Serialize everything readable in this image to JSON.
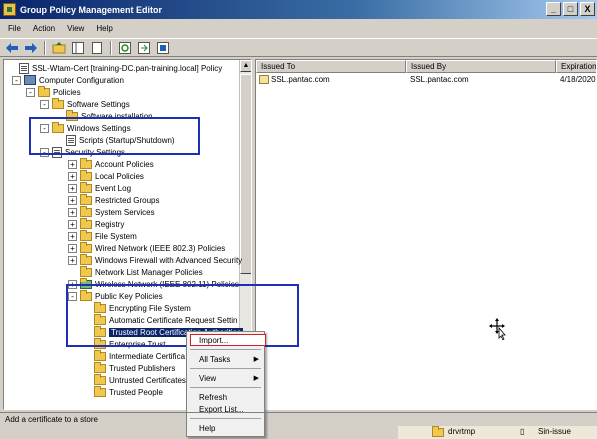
{
  "window": {
    "title": "Group Policy Management Editor",
    "buttons": [
      "_",
      "□",
      "X"
    ]
  },
  "menubar": [
    "File",
    "Action",
    "View",
    "Help"
  ],
  "toolbar": [
    "back-icon",
    "forward-icon",
    "up-icon",
    "show-hide-tree-icon",
    "properties-icon",
    "refresh-icon",
    "export-icon",
    "help-icon"
  ],
  "tree": [
    {
      "label": "SSL-Wtam-Cert [training-DC.pan-training.local] Policy",
      "icon": "document-icon",
      "exp": ""
    },
    {
      "label": "Computer Configuration",
      "icon": "computer-icon",
      "exp": "-"
    },
    {
      "label": "Policies",
      "icon": "folder-icon",
      "exp": "-"
    },
    {
      "label": "Software Settings",
      "icon": "folder-icon",
      "exp": "-"
    },
    {
      "label": "Software installation",
      "icon": "folder-icon",
      "exp": ""
    },
    {
      "label": "Windows Settings",
      "icon": "folder-icon",
      "exp": "-"
    },
    {
      "label": "Scripts (Startup/Shutdown)",
      "icon": "document-icon",
      "exp": ""
    },
    {
      "label": "Security Settings",
      "icon": "security-icon",
      "exp": "-"
    },
    {
      "label": "Account Policies",
      "icon": "folder-icon",
      "exp": "+"
    },
    {
      "label": "Local Policies",
      "icon": "folder-icon",
      "exp": "+"
    },
    {
      "label": "Event Log",
      "icon": "folder-icon",
      "exp": "+"
    },
    {
      "label": "Restricted Groups",
      "icon": "folder-icon",
      "exp": "+"
    },
    {
      "label": "System Services",
      "icon": "folder-icon",
      "exp": "+"
    },
    {
      "label": "Registry",
      "icon": "folder-icon",
      "exp": "+"
    },
    {
      "label": "File System",
      "icon": "folder-icon",
      "exp": "+"
    },
    {
      "label": "Wired Network (IEEE 802.3) Policies",
      "icon": "folder-icon",
      "exp": "+"
    },
    {
      "label": "Windows Firewall with Advanced Security",
      "icon": "folder-icon",
      "exp": "+"
    },
    {
      "label": "Network List Manager Policies",
      "icon": "folder-icon",
      "exp": ""
    },
    {
      "label": "Wireless Network (IEEE 802.11) Policies",
      "icon": "wireless-icon",
      "exp": "+"
    },
    {
      "label": "Public Key Policies",
      "icon": "folder-icon",
      "exp": "-"
    },
    {
      "label": "Encrypting File System",
      "icon": "folder-icon",
      "exp": ""
    },
    {
      "label": "Automatic Certificate Request Settin",
      "icon": "folder-icon",
      "exp": ""
    },
    {
      "label": "Trusted Root Certification Authorities",
      "icon": "folder-icon",
      "exp": ""
    },
    {
      "label": "Enterprise Trust",
      "icon": "folder-icon",
      "exp": ""
    },
    {
      "label": "Intermediate Certifica",
      "icon": "folder-icon",
      "exp": ""
    },
    {
      "label": "Trusted Publishers",
      "icon": "folder-icon",
      "exp": ""
    },
    {
      "label": "Untrusted Certificates",
      "icon": "folder-icon",
      "exp": ""
    },
    {
      "label": "Trusted People",
      "icon": "folder-icon",
      "exp": ""
    }
  ],
  "table": {
    "headers": [
      "Issued To",
      "Issued By",
      "Expiration"
    ],
    "rows": [
      [
        "SSL.pantac.com",
        "SSL.pantac.com",
        "4/18/2020"
      ]
    ]
  },
  "context_menu": {
    "items": [
      "Import...",
      "All Tasks",
      "View",
      "Refresh",
      "Export List...",
      "Help"
    ]
  },
  "status": "Add a certificate to a store",
  "taskbar": [
    "drvrtmp",
    "Sin-issue"
  ],
  "colors": {
    "titlebar": "#0a246a",
    "highlight_box": "#1f2fb8",
    "import_box": "#d02020",
    "selection": "#0a246a"
  }
}
